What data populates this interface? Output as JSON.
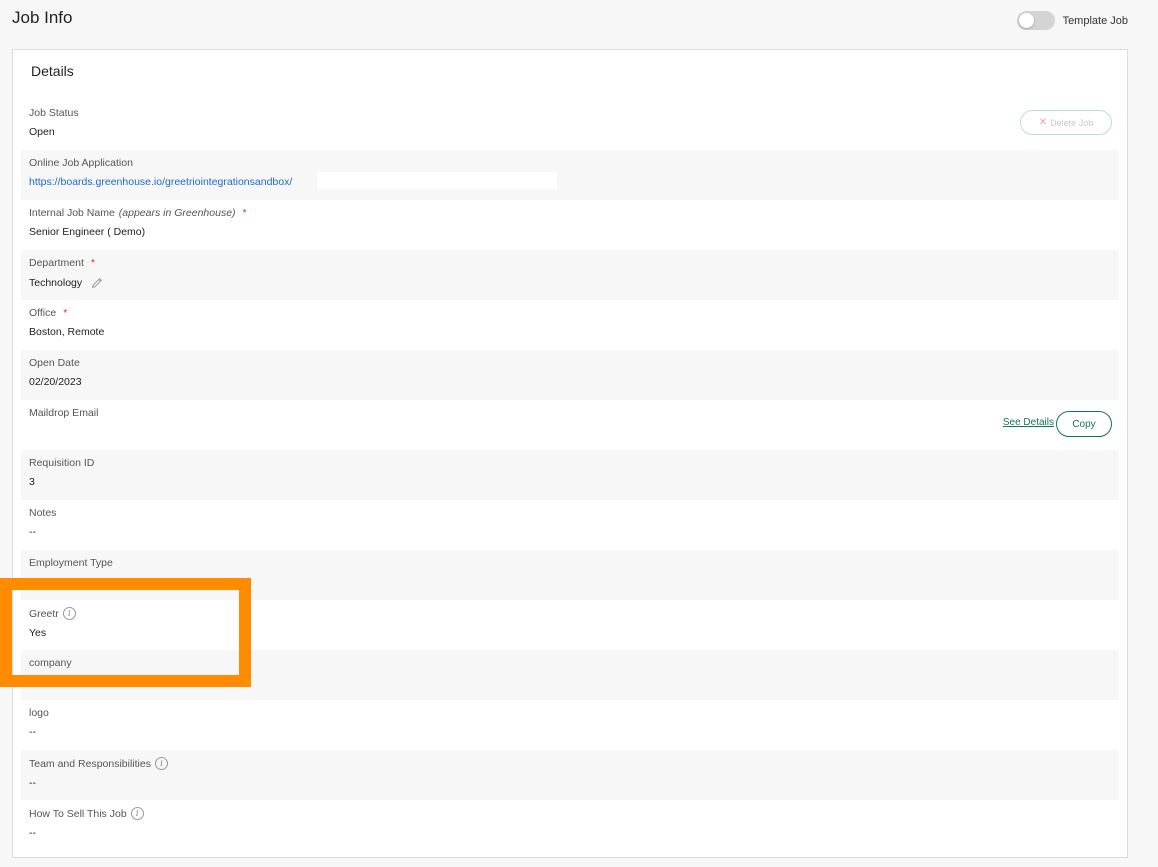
{
  "header": {
    "title": "Job Info",
    "template_toggle_label": "Template Job",
    "template_toggle_on": false
  },
  "card": {
    "title": "Details",
    "delete_button": "Delete Job",
    "delete_icon": "x-icon",
    "see_details": "See Details",
    "copy_button": "Copy"
  },
  "fields": {
    "job_status": {
      "label": "Job Status",
      "value": "Open"
    },
    "online_application": {
      "label": "Online Job Application",
      "value": "https://boards.greenhouse.io/greetriointegrationsandbox/"
    },
    "internal_name": {
      "label": "Internal Job Name",
      "label_note": "(appears in Greenhouse)",
      "value": "Senior Engineer ( Demo)"
    },
    "department": {
      "label": "Department",
      "value": "Technology"
    },
    "office": {
      "label": "Office",
      "value": "Boston, Remote"
    },
    "open_date": {
      "label": "Open Date",
      "value": "02/20/2023"
    },
    "maildrop": {
      "label": "Maildrop Email",
      "value": ""
    },
    "requisition": {
      "label": "Requisition ID",
      "value": "3"
    },
    "notes": {
      "label": "Notes",
      "value": "--"
    },
    "employment_type": {
      "label": "Employment Type",
      "value": ""
    },
    "greetr": {
      "label": "Greetr",
      "value": "Yes"
    },
    "company": {
      "label": "company",
      "value": ""
    },
    "logo": {
      "label": "logo",
      "value": "--"
    },
    "team": {
      "label": "Team and Responsibilities",
      "value": "--"
    },
    "sell": {
      "label": "How To Sell This Job",
      "value": "--"
    }
  },
  "required_marker": "*",
  "colors": {
    "accent": "#15755a",
    "link": "#1b6ad1",
    "required": "#d0342c",
    "highlight": "#ff8c00"
  }
}
